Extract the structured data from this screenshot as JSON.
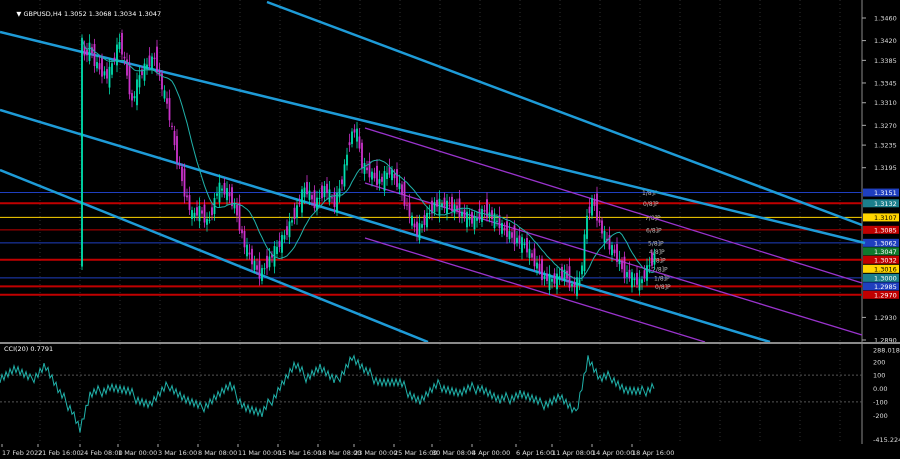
{
  "chart_info": {
    "symbol_timeframe": "GBPUSD,H4",
    "ohlc": "1.3052 1.3068 1.3034 1.3047"
  },
  "price_axis": {
    "labels": [
      "1.3460",
      "1.3420",
      "1.3385",
      "1.3345",
      "1.3310",
      "1.3270",
      "1.3235",
      "1.3195",
      "1.2930",
      "1.2890"
    ]
  },
  "price_tags": [
    {
      "text": "1.3151",
      "bg": "#1f3fbf",
      "fg": "#ffffff",
      "price": 1.3151
    },
    {
      "text": "1.3132",
      "bg": "#1b7f8c",
      "fg": "#ffffff",
      "price": 1.3132
    },
    {
      "text": "1.3107",
      "bg": "#ffd500",
      "fg": "#000000",
      "price": 1.3107
    },
    {
      "text": "1.3085",
      "bg": "#c00000",
      "fg": "#ffffff",
      "price": 1.3085
    },
    {
      "text": "1.3062",
      "bg": "#1f3fbf",
      "fg": "#ffffff",
      "price": 1.3062
    },
    {
      "text": "1.3047",
      "bg": "#107a2e",
      "fg": "#ffffff",
      "price": 1.3047
    },
    {
      "text": "1.3032",
      "bg": "#c00000",
      "fg": "#ffffff",
      "price": 1.3032
    },
    {
      "text": "1.3016",
      "bg": "#ffd500",
      "fg": "#000000",
      "price": 1.3016
    },
    {
      "text": "1.3000",
      "bg": "#1b7f8c",
      "fg": "#ffffff",
      "price": 1.3
    },
    {
      "text": "1.2985",
      "bg": "#1f3fbf",
      "fg": "#ffffff",
      "price": 1.2985
    },
    {
      "text": "1.2970",
      "bg": "#c00000",
      "fg": "#ffffff",
      "price": 1.297
    }
  ],
  "murray_labels": [
    "1/8]P",
    "0/8]P",
    "7/8]P",
    "6/8]P",
    "5/8]P",
    "4/8]P",
    "3/8]P",
    "2/8]P",
    "1/8]P",
    "0/8]P"
  ],
  "oscillator": {
    "title": "CCI(20) 0.7791",
    "axis_labels": [
      "288.018",
      "200",
      "100",
      "0.00",
      "-100",
      "-200",
      "-415.224"
    ]
  },
  "time_axis": {
    "labels": [
      "17 Feb 2022",
      "21 Feb 16:00",
      "24 Feb 08:00",
      "1 Mar 00:00",
      "3 Mar 16:00",
      "8 Mar 08:00",
      "11 Mar 00:00",
      "15 Mar 16:00",
      "18 Mar 08:00",
      "23 Mar 00:00",
      "25 Mar 16:00",
      "30 Mar 08:00",
      "4 Apr 00:00",
      "6 Apr 16:00",
      "11 Apr 08:00",
      "14 Apr 00:00",
      "18 Apr 16:00"
    ]
  },
  "colors": {
    "bull": "#00e0b0",
    "bear": "#cc33cc",
    "ma": "#20b2aa",
    "channel": "#1e9bd7",
    "small_channel": "#9933cc",
    "level_red": "#c00000",
    "level_blue": "#1f3fbf",
    "osc_line": "#20b2aa"
  }
}
